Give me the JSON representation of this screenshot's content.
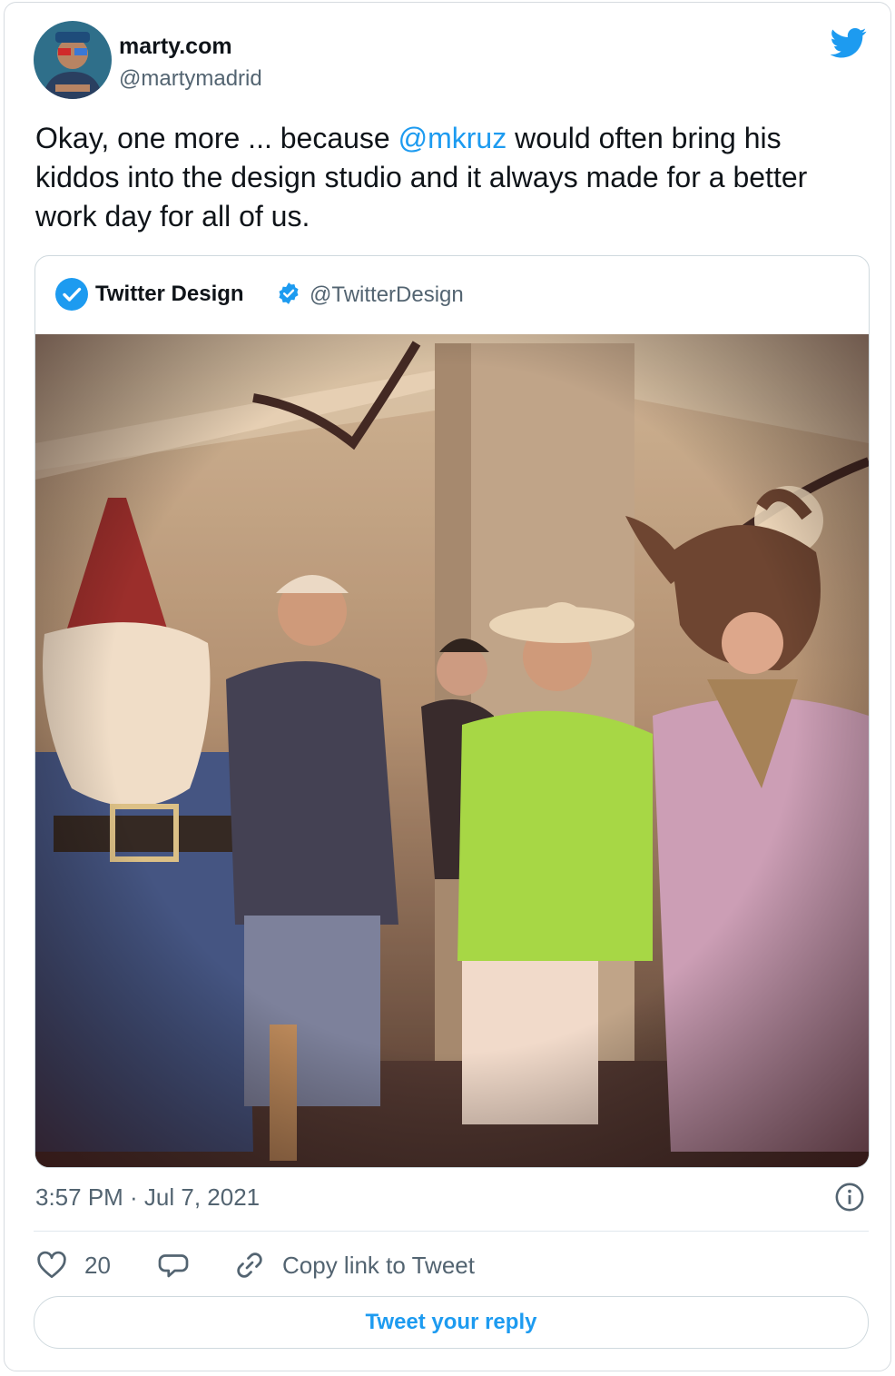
{
  "author": {
    "name": "marty.com",
    "handle": "@martymadrid"
  },
  "tweet": {
    "text_before": "Okay, one more ... because ",
    "mention": "@mkruz",
    "text_after": " would often bring his kiddos into the design studio and it always made for a better work day for all of us."
  },
  "quoted": {
    "name": "Twitter Design",
    "handle": "@TwitterDesign"
  },
  "meta": {
    "timestamp": "3:57 PM · Jul 7, 2021"
  },
  "actions": {
    "like_count": "20",
    "copy_link": "Copy link to Tweet"
  },
  "reply_button": "Tweet your reply",
  "colors": {
    "accent": "#1d9bf0",
    "text": "#0f1419",
    "muted": "#536471"
  },
  "icons": [
    "twitter-bird-icon",
    "verified-badge-icon",
    "info-icon",
    "heart-icon",
    "reply-bubble-icon",
    "link-icon"
  ]
}
